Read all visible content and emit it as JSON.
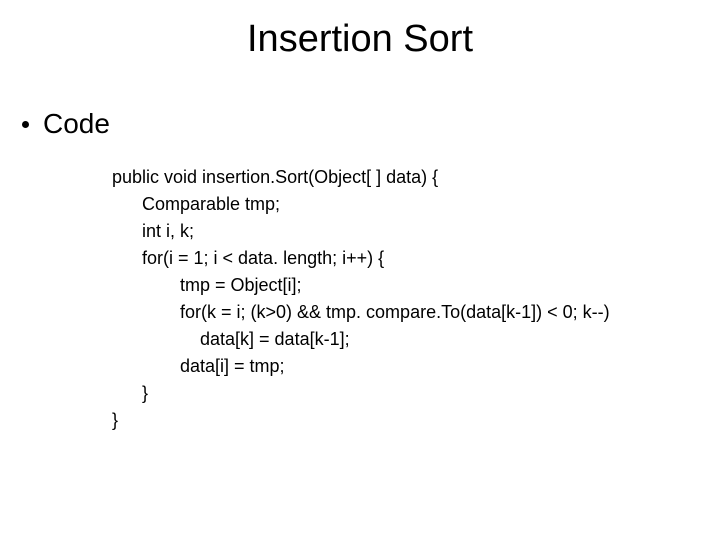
{
  "title": "Insertion Sort",
  "bullet": "Code",
  "code": {
    "l0": "public void insertion.Sort(Object[ ] data) {",
    "l1": "Comparable tmp;",
    "l2": "int i, k;",
    "l3": "for(i = 1; i < data. length; i++) {",
    "l4": "tmp = Object[i];",
    "l5": "for(k = i; (k>0) && tmp. compare.To(data[k-1]) < 0; k--)",
    "l6": "data[k] = data[k-1];",
    "l7": "data[i] = tmp;",
    "l8": "}",
    "l9": "}"
  }
}
